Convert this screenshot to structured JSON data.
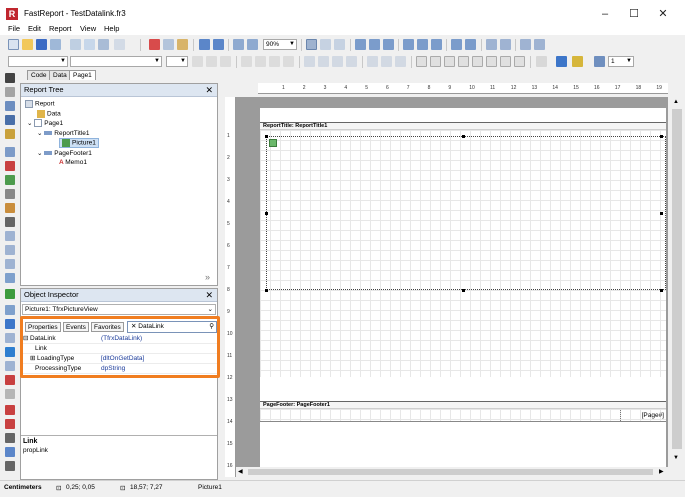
{
  "window": {
    "title": "FastReport - TestDatalink.fr3",
    "logo_letter": "R",
    "controls": {
      "minimize": "–",
      "maximize": "☐",
      "close": "✕"
    }
  },
  "menu": [
    "File",
    "Edit",
    "Report",
    "View",
    "Help"
  ],
  "toolbar": {
    "zoom_value": "90%",
    "font_size_value": "1"
  },
  "doc_tabs": [
    "Code",
    "Data",
    "Page1"
  ],
  "report_tree": {
    "title": "Report Tree",
    "nodes": [
      {
        "label": "Report",
        "icon": "report-icon",
        "level": 0
      },
      {
        "label": "Data",
        "icon": "data-icon",
        "level": 1
      },
      {
        "label": "Page1",
        "icon": "page-icon",
        "level": 1
      },
      {
        "label": "ReportTitle1",
        "icon": "band-icon",
        "level": 2
      },
      {
        "label": "Picture1",
        "icon": "picture-icon",
        "level": 3
      },
      {
        "label": "PageFooter1",
        "icon": "band-icon",
        "level": 2
      },
      {
        "label": "Memo1",
        "icon": "memo-icon",
        "level": 3
      }
    ]
  },
  "object_inspector": {
    "title": "Object Inspector",
    "selected_object": "Picture1: TfrxPictureView",
    "tabs": [
      "Properties",
      "Events",
      "Favorites"
    ],
    "search_value": "DataLink",
    "properties": [
      {
        "name": "DataLink",
        "value": "(TfrxDataLink)",
        "expander": "⊟"
      },
      {
        "name": "Link",
        "value": "",
        "expander": ""
      },
      {
        "name": "LoadingType",
        "value": "[dltOnGetData]",
        "expander": "⊞"
      },
      {
        "name": "ProcessingType",
        "value": "dpString",
        "expander": ""
      }
    ],
    "help_title": "Link",
    "help_text": "propLink"
  },
  "report_page": {
    "ruler_labels": [
      "1",
      "2",
      "3",
      "4",
      "5",
      "6",
      "7",
      "8",
      "9",
      "10",
      "11",
      "12",
      "13",
      "14",
      "15",
      "16",
      "17",
      "18",
      "19"
    ],
    "vruler_labels": [
      "1",
      "2",
      "3",
      "4",
      "5",
      "6",
      "7",
      "8",
      "9",
      "10",
      "11",
      "12",
      "13",
      "14",
      "15",
      "16"
    ],
    "title_band": "ReportTitle: ReportTitle1",
    "footer_band": "PageFooter: PageFooter1",
    "footer_memo": "[Page#]"
  },
  "status": {
    "units": "Centimeters",
    "position": "0,25; 0,05",
    "size": "18,57; 7,27",
    "object": "Picture1"
  },
  "colors": {
    "highlight": "#f07d20",
    "panel_head": "#dde6f1"
  }
}
